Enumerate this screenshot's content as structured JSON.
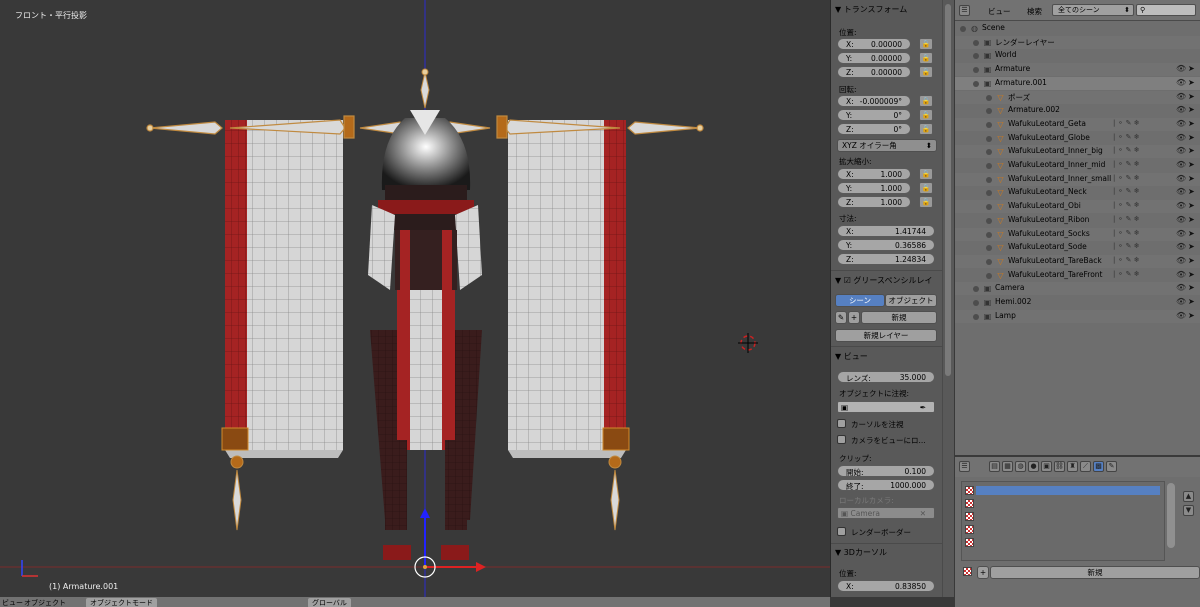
{
  "viewport": {
    "title": "フロント・平行投影",
    "status": "(1) Armature.001"
  },
  "bottombar": {
    "view_label": "ビュー",
    "object_menu": "オブジェクト",
    "mode": "オブジェクトモード",
    "pivot": "グローバル"
  },
  "props": {
    "transform_title": "トランスフォーム",
    "location_label": "位置:",
    "location": [
      {
        "k": "X:",
        "v": "0.00000"
      },
      {
        "k": "Y:",
        "v": "0.00000"
      },
      {
        "k": "Z:",
        "v": "0.00000"
      }
    ],
    "rotation_label": "回転:",
    "rotation": [
      {
        "k": "X:",
        "v": "-0.000009°"
      },
      {
        "k": "Y:",
        "v": "0°"
      },
      {
        "k": "Z:",
        "v": "0°"
      }
    ],
    "rotation_mode": "XYZ オイラー角",
    "scale_label": "拡大縮小:",
    "scale": [
      {
        "k": "X:",
        "v": "1.000"
      },
      {
        "k": "Y:",
        "v": "1.000"
      },
      {
        "k": "Z:",
        "v": "1.000"
      }
    ],
    "dimensions_label": "寸法:",
    "dimensions": [
      {
        "k": "X:",
        "v": "1.41744"
      },
      {
        "k": "Y:",
        "v": "0.36586"
      },
      {
        "k": "Z:",
        "v": "1.24834"
      }
    ],
    "grease_title": "グリースペンシルレイ",
    "grease_scene": "シーン",
    "grease_object": "オブジェクト",
    "grease_new": "新規",
    "grease_new_layer": "新規レイヤー",
    "view_title": "ビュー",
    "lens_label": "レンズ:",
    "lens_value": "35.000",
    "lock_object_label": "オブジェクトに注視:",
    "lock_cursor": "カーソルを注視",
    "camera_to_view": "カメラをビューにロ...",
    "clip_label": "クリップ:",
    "clip_start_k": "開始:",
    "clip_start_v": "0.100",
    "clip_end_k": "終了:",
    "clip_end_v": "1000.000",
    "local_camera_label": "ローカルカメラ:",
    "local_camera_value": "Camera",
    "render_border": "レンダーボーダー",
    "cursor_title": "3Dカーソル",
    "cursor_location_label": "位置:",
    "cursor_x_k": "X:",
    "cursor_x_v": "0.83850"
  },
  "outliner": {
    "view_menu": "ビュー",
    "search_menu": "検索",
    "display_mode": "全てのシーン",
    "rows": [
      {
        "name": "Scene",
        "indent": 0
      },
      {
        "name": "レンダーレイヤー",
        "indent": 1
      },
      {
        "name": "World",
        "indent": 1
      },
      {
        "name": "Armature",
        "indent": 1
      },
      {
        "name": "Armature.001",
        "indent": 1
      },
      {
        "name": "ポーズ",
        "indent": 2
      },
      {
        "name": "Armature.002",
        "indent": 2
      },
      {
        "name": "WafukuLeotard_Geta",
        "indent": 2
      },
      {
        "name": "WafukuLeotard_Globe",
        "indent": 2
      },
      {
        "name": "WafukuLeotard_Inner_big",
        "indent": 2
      },
      {
        "name": "WafukuLeotard_Inner_mid",
        "indent": 2
      },
      {
        "name": "WafukuLeotard_Inner_small",
        "indent": 2
      },
      {
        "name": "WafukuLeotard_Neck",
        "indent": 2
      },
      {
        "name": "WafukuLeotard_Obi",
        "indent": 2
      },
      {
        "name": "WafukuLeotard_Ribon",
        "indent": 2
      },
      {
        "name": "WafukuLeotard_Socks",
        "indent": 2
      },
      {
        "name": "WafukuLeotard_Sode",
        "indent": 2
      },
      {
        "name": "WafukuLeotard_TareBack",
        "indent": 2
      },
      {
        "name": "WafukuLeotard_TareFront",
        "indent": 2
      },
      {
        "name": "Camera",
        "indent": 1
      },
      {
        "name": "Hemi.002",
        "indent": 1
      },
      {
        "name": "Lamp",
        "indent": 1
      }
    ]
  },
  "texpanel": {
    "new_button": "新規"
  },
  "colors": {
    "bg": "#393939",
    "panel": "#595959",
    "accent": "#5680c2",
    "fabric_red": "#a52323"
  }
}
